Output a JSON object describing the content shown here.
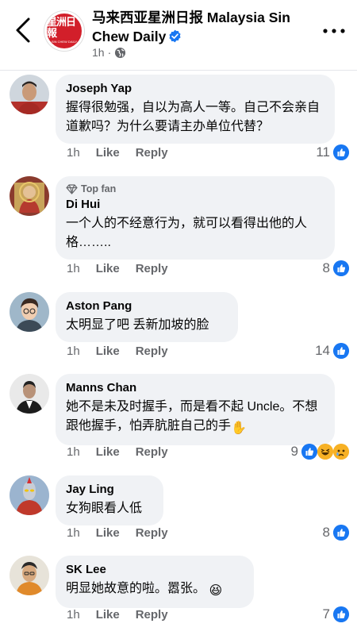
{
  "header": {
    "page_name": "马来西亚星洲日报 Malaysia Sin Chew Daily",
    "post_time": "1h",
    "meta_separator": "·",
    "logo_cn": "星洲日報",
    "logo_en": "SIN CHEW DAILY"
  },
  "comments": [
    {
      "name": "Joseph Yap",
      "top_fan": false,
      "text": "握得很勉强，自以为高人一等。自己不会亲自道歉吗？为什么要请主办单位代替？",
      "time": "1h",
      "like": "Like",
      "reply": "Reply",
      "reaction_count": "11",
      "reactions": [
        "like"
      ]
    },
    {
      "name": "Di Hui",
      "top_fan": true,
      "top_fan_label": "Top fan",
      "text": "一个人的不经意行为，就可以看得出他的人格……..",
      "time": "1h",
      "like": "Like",
      "reply": "Reply",
      "reaction_count": "8",
      "reactions": [
        "like"
      ]
    },
    {
      "name": "Aston Pang",
      "top_fan": false,
      "text": "太明显了吧 丢新加坡的脸",
      "time": "1h",
      "like": "Like",
      "reply": "Reply",
      "reaction_count": "14",
      "reactions": [
        "like"
      ]
    },
    {
      "name": "Manns Chan",
      "top_fan": false,
      "text": "她不是未及时握手，而是看不起 Uncle。不想跟他握手，怕弄肮脏自己的手",
      "emoji": "✋",
      "time": "1h",
      "like": "Like",
      "reply": "Reply",
      "reaction_count": "9",
      "reactions": [
        "like",
        "haha",
        "sad"
      ]
    },
    {
      "name": "Jay Ling",
      "top_fan": false,
      "text": "女狗眼看人低",
      "time": "1h",
      "like": "Like",
      "reply": "Reply",
      "reaction_count": "8",
      "reactions": [
        "like"
      ]
    },
    {
      "name": "SK Lee",
      "top_fan": false,
      "text": "明显她故意的啦。嚣张。",
      "emoji": "😆",
      "time": "1h",
      "like": "Like",
      "reply": "Reply",
      "reaction_count": "7",
      "reactions": [
        "like"
      ]
    }
  ],
  "colors": {
    "like_blue": "#1877f2",
    "bubble_bg": "#f0f2f5",
    "secondary_text": "#65676b",
    "logo_red": "#d21f2a"
  },
  "icons": [
    "back-chevron-icon",
    "verified-badge-icon",
    "globe-icon",
    "more-options-icon",
    "top-fan-diamond-icon",
    "like-reaction-icon",
    "haha-reaction-icon",
    "sad-reaction-icon"
  ]
}
